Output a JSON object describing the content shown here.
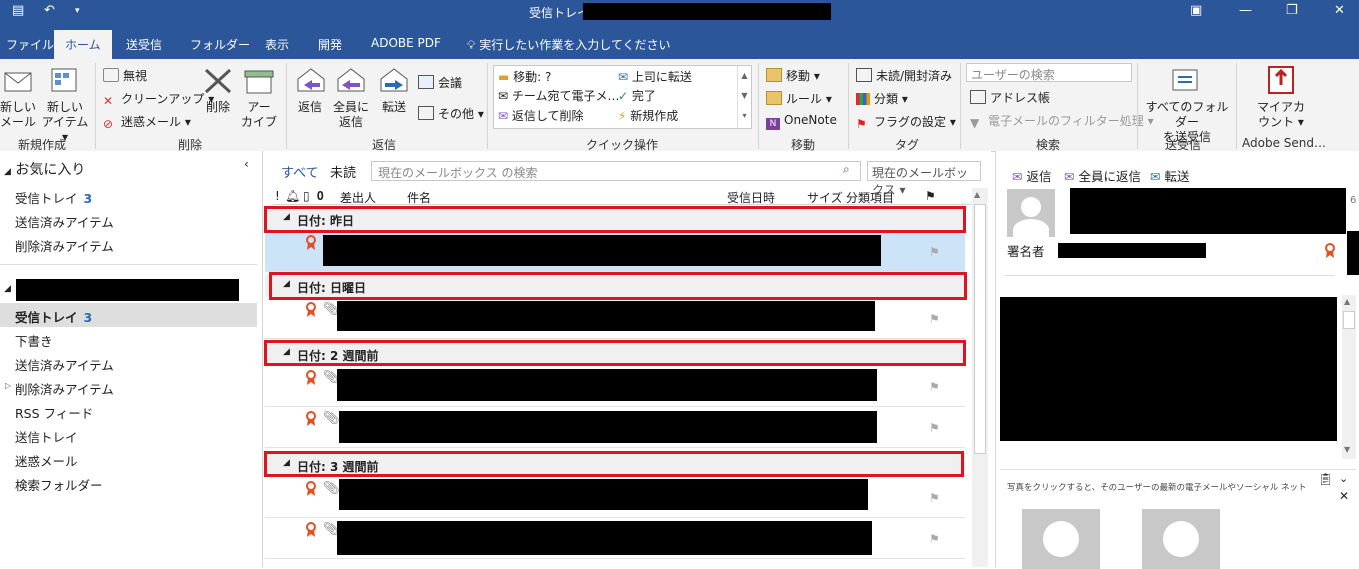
{
  "title_bar": {
    "title": "受信トレイ"
  },
  "tabs": [
    "ファイル",
    "ホーム",
    "送受信",
    "フォルダー",
    "表示",
    "開発",
    "ADOBE PDF"
  ],
  "tell_me": "実行したい作業を入力してください",
  "ribbon": {
    "new": {
      "new_mail_1": "新しい",
      "new_mail_2": "メール",
      "new_item_1": "新しい",
      "new_item_2": "アイテム ▾",
      "label": "新規作成"
    },
    "delete": {
      "ignore": "無視",
      "cleanup": "クリーンアップ ▾",
      "junk": "迷惑メール ▾",
      "delete": "削除",
      "archive_1": "アー",
      "archive_2": "カイブ",
      "label": "削除"
    },
    "respond": {
      "reply": "返信",
      "reply_all_1": "全員に",
      "reply_all_2": "返信",
      "forward": "転送",
      "meeting": "会議",
      "more": "その他 ▾",
      "label": "返信"
    },
    "quick_steps": {
      "move": "移動: ?",
      "team": "チーム宛て電子メ…",
      "reply_delete": "返信して削除",
      "to_manager": "上司に転送",
      "done": "完了",
      "create_new": "新規作成",
      "label": "クイック操作"
    },
    "move": {
      "move": "移動 ▾",
      "rules": "ルール ▾",
      "onenote": "OneNote",
      "label": "移動"
    },
    "tags": {
      "unread_read": "未読/開封済み",
      "categorize": "分類 ▾",
      "follow_up": "フラグの設定 ▾",
      "label": "タグ"
    },
    "find": {
      "search_people": "ユーザーの検索",
      "address_book": "アドレス帳",
      "filter_email": "電子メールのフィルター処理 ▾",
      "label": "検索"
    },
    "send_receive": {
      "all_1": "すべてのフォルダー",
      "all_2": "を送受信",
      "label": "送受信"
    },
    "adobe": {
      "my_account_1": "マイアカ",
      "my_account_2": "ウント ▾",
      "label": "Adobe Send…"
    }
  },
  "folder_pane": {
    "favorites": "お気に入り",
    "fav_items": [
      {
        "name": "受信トレイ",
        "count": "3"
      },
      {
        "name": "送信済みアイテム",
        "count": ""
      },
      {
        "name": "削除済みアイテム",
        "count": ""
      }
    ],
    "mailbox_items": [
      {
        "name": "受信トレイ",
        "count": "3"
      },
      {
        "name": "下書き",
        "count": ""
      },
      {
        "name": "送信済みアイテム",
        "count": ""
      },
      {
        "name": "削除済みアイテム",
        "count": ""
      },
      {
        "name": "RSS フィード",
        "count": ""
      },
      {
        "name": "送信トレイ",
        "count": ""
      },
      {
        "name": "迷惑メール",
        "count": ""
      },
      {
        "name": "検索フォルダー",
        "count": ""
      }
    ]
  },
  "mail_list": {
    "filter_all": "すべて",
    "filter_unread": "未読",
    "search_placeholder": "現在のメールボックス の検索",
    "scope": "現在のメールボックス",
    "columns": {
      "from": "差出人",
      "subject": "件名",
      "received": "受信日時",
      "size": "サイズ",
      "category": "分類項目"
    },
    "groups": [
      "日付: 昨日",
      "日付: 日曜日",
      "日付: 2 週間前",
      "日付: 3 週間前"
    ]
  },
  "reading_pane": {
    "reply": "返信",
    "reply_all": "全員に返信",
    "forward": "転送",
    "signer": "署名者",
    "people_note": "写真をクリックすると、そのユーザーの最新の電子メールやソーシャル ネットワークの更新…"
  },
  "colors": {
    "accent": "#2b579a",
    "highlight_box": "#e0141e",
    "selected_row": "#cce3f8"
  }
}
